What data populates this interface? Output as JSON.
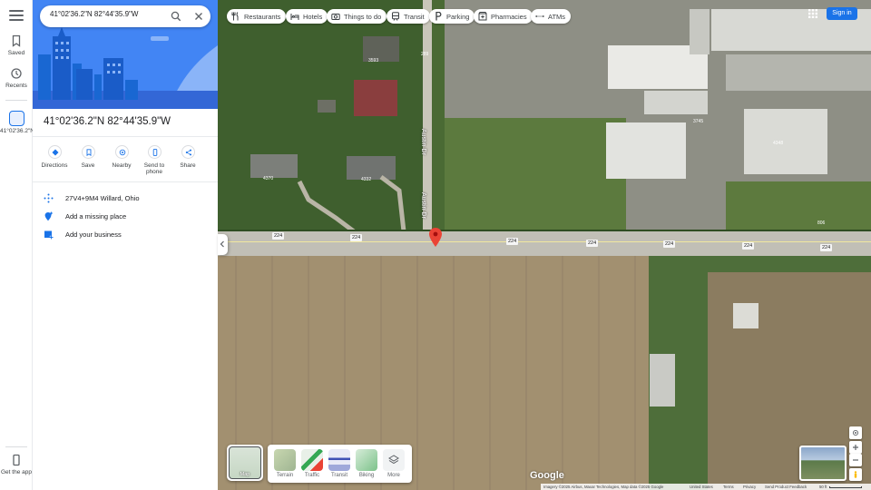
{
  "search": {
    "value": "41°02'36.2\"N 82°44'35.9\"W"
  },
  "rail": {
    "saved": "Saved",
    "recents": "Recents",
    "current_place": "41°02'36.2\"N",
    "get_app": "Get the app"
  },
  "place": {
    "title": "41°02'36.2\"N 82°44'35.9\"W",
    "actions": [
      {
        "label": "Directions",
        "icon": "directions-icon"
      },
      {
        "label": "Save",
        "icon": "bookmark-icon"
      },
      {
        "label": "Nearby",
        "icon": "nearby-icon"
      },
      {
        "label": "Send to phone",
        "icon": "phone-icon"
      },
      {
        "label": "Share",
        "icon": "share-icon"
      }
    ],
    "plus_code": "27V4+9M4 Willard, Ohio",
    "add_missing_place": "Add a missing place",
    "add_business": "Add your business"
  },
  "chips": [
    {
      "label": "Restaurants",
      "icon": "restaurant-icon"
    },
    {
      "label": "Hotels",
      "icon": "hotel-icon"
    },
    {
      "label": "Things to do",
      "icon": "camera-icon"
    },
    {
      "label": "Transit",
      "icon": "transit-icon"
    },
    {
      "label": "Parking",
      "icon": "parking-icon"
    },
    {
      "label": "Pharmacies",
      "icon": "pharmacy-icon"
    },
    {
      "label": "ATMs",
      "icon": "atm-icon"
    }
  ],
  "header": {
    "sign_in": "Sign in"
  },
  "map": {
    "route_labels": [
      "224",
      "224",
      "224",
      "224",
      "224",
      "224",
      "224"
    ],
    "street_name": "Austin Dr",
    "numbers": [
      "289",
      "3593",
      "3745",
      "4348",
      "4370",
      "4332",
      "806",
      "4329"
    ]
  },
  "layers": {
    "current": "Map",
    "options": [
      "Terrain",
      "Traffic",
      "Transit",
      "Biking",
      "More"
    ]
  },
  "footer": {
    "logo": "Google",
    "imagery": "Imagery ©2025 Airbus, Maxar Technologies, Map data ©2025 Google",
    "country": "United States",
    "terms": "Terms",
    "privacy": "Privacy",
    "feedback": "Send Product Feedback",
    "scale": "50 ft"
  },
  "colors": {
    "accent": "#1a73e8",
    "pin": "#ea4335",
    "hero": "#4285f4"
  }
}
